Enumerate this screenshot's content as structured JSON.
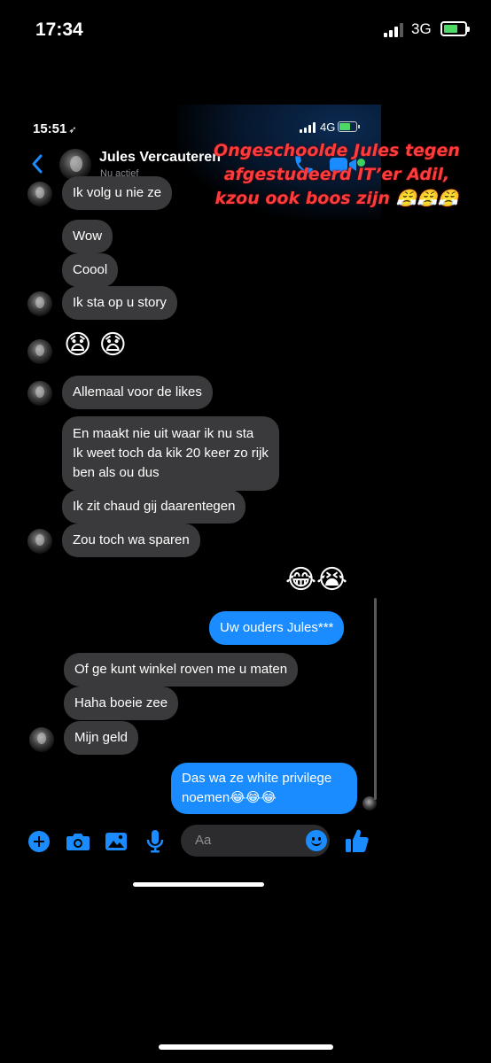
{
  "outer_status": {
    "time": "17:34",
    "network": "3G"
  },
  "inner_status": {
    "time": "15:51",
    "network": "4G"
  },
  "header": {
    "name": "Jules Vercauteren",
    "status": "Nu actief"
  },
  "messages": [
    {
      "text": "Ik volg u nie ze",
      "sender": "contact"
    },
    {
      "text": "Wow",
      "sender": "contact"
    },
    {
      "text": "Coool",
      "sender": "contact"
    },
    {
      "text": "Ik sta op u story",
      "sender": "contact"
    },
    {
      "text": "😧 😧",
      "sender": "contact"
    },
    {
      "text": "Allemaal voor de likes",
      "sender": "contact"
    },
    {
      "text": "En maakt nie uit waar ik nu sta\nIk weet toch da kik 20 keer zo rijk\nben als ou dus",
      "sender": "contact"
    },
    {
      "text": "Ik zit chaud gij daarentegen",
      "sender": "contact"
    },
    {
      "text": "Zou toch wa sparen",
      "sender": "contact"
    },
    {
      "text": "😂😭",
      "sender": "me"
    },
    {
      "text": "Uw ouders Jules***",
      "sender": "me"
    },
    {
      "text": "Of ge kunt winkel roven me u maten",
      "sender": "contact"
    },
    {
      "text": "Haha boeie zee",
      "sender": "contact"
    },
    {
      "text": "Mijn geld",
      "sender": "contact"
    },
    {
      "text": "Das wa ze white privilege\nnoemen😂😂😂",
      "sender": "me"
    }
  ],
  "caption": "Ongeschoolde Jules tegen\nafgestudeerd IT’er  Adil,\nkzou ook boos zijn 😤😤😤",
  "composer": {
    "placeholder": "Aa"
  },
  "colors": {
    "incoming_bubble": "#3a3a3c",
    "outgoing_bubble": "#1a8cff",
    "accent": "#1a8cff",
    "caption": "#ff3b3b"
  },
  "icons": [
    "back-icon",
    "call-icon",
    "video-icon",
    "plus-icon",
    "camera-icon",
    "gallery-icon",
    "mic-icon",
    "emoji-icon",
    "thumbs-up-icon"
  ]
}
